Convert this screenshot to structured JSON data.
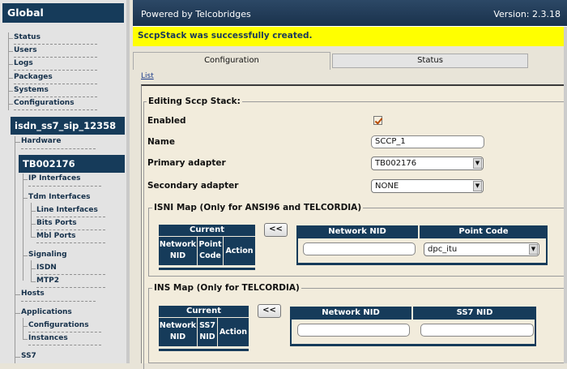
{
  "sidebar": {
    "global_title": "Global",
    "items": [
      "Status",
      "Users",
      "Logs",
      "Packages",
      "Systems",
      "Configurations"
    ],
    "system_name": "isdn_ss7_sip_12358",
    "hardware": "Hardware",
    "device": "TB002176",
    "ip_interfaces": "IP Interfaces",
    "tdm_interfaces": "Tdm Interfaces",
    "line_interfaces": "Line Interfaces",
    "bits_ports": "Bits Ports",
    "mbl_ports": "Mbl Ports",
    "signaling": "Signaling",
    "isdn": "ISDN",
    "mtp2": "MTP2",
    "hosts": "Hosts",
    "applications": "Applications",
    "app_configurations": "Configurations",
    "instances": "Instances",
    "ss7": "SS7"
  },
  "topbar": {
    "powered_by": "Powered by Telcobridges",
    "version": "Version: 2.3.18"
  },
  "banner": "SccpStack was successfully created.",
  "tabs": [
    "Configuration",
    "Status"
  ],
  "list_link": "List",
  "form": {
    "legend": "Editing Sccp Stack:",
    "enabled_label": "Enabled",
    "enabled": true,
    "name_label": "Name",
    "name_value": "SCCP_1",
    "primary_label": "Primary adapter",
    "primary_value": "TB002176",
    "secondary_label": "Secondary adapter",
    "secondary_value": "NONE"
  },
  "isni": {
    "legend": "ISNI Map (Only for ANSI96 and TELCORDIA)",
    "current": "Current",
    "col_network": [
      "Network",
      "NID"
    ],
    "col_point": [
      "Point",
      "Code"
    ],
    "col_action": "Action",
    "add_button": "<<",
    "network_nid_header": "Network NID",
    "point_code_header": "Point Code",
    "point_code_value": "dpc_itu"
  },
  "ins": {
    "legend": "INS Map (Only for TELCORDIA)",
    "current": "Current",
    "col_network": [
      "Network",
      "NID"
    ],
    "col_ss7": [
      "SS7",
      "NID"
    ],
    "col_action": "Action",
    "add_button": "<<",
    "network_nid_header": "Network NID",
    "ss7_nid_header": "SS7 NID"
  }
}
